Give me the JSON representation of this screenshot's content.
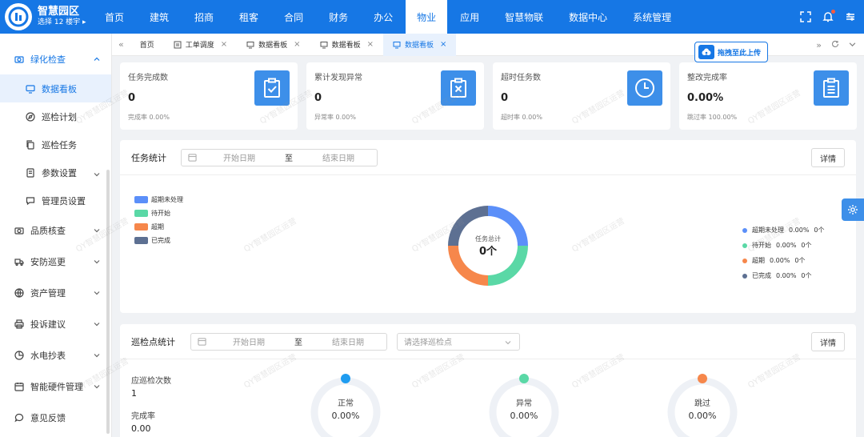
{
  "app": {
    "title": "智慧园区",
    "building_selector": "选择 12 楼宇",
    "colors": {
      "primary": "#1677e5",
      "card_icon": "#3d8fe9"
    }
  },
  "topnav": {
    "items": [
      "首页",
      "建筑",
      "招商",
      "租客",
      "合同",
      "财务",
      "办公",
      "物业",
      "应用",
      "智慧物联",
      "数据中心",
      "系统管理"
    ],
    "active": "物业"
  },
  "sidebar": {
    "group_open": "绿化检查",
    "sub_items": [
      "数据看板",
      "巡检计划",
      "巡检任务",
      "参数设置",
      "管理员设置"
    ],
    "active_sub": "数据看板",
    "groups": [
      "品质核查",
      "安防巡更",
      "资产管理",
      "投诉建议",
      "水电抄表",
      "智能硬件管理",
      "意见反馈"
    ]
  },
  "tabs": {
    "items": [
      {
        "label": "首页",
        "closable": false
      },
      {
        "label": "工单调度",
        "closable": true
      },
      {
        "label": "数据看板",
        "closable": true
      },
      {
        "label": "数据看板",
        "closable": true
      },
      {
        "label": "数据看板",
        "closable": true
      }
    ],
    "active_index": 4
  },
  "upload_button": "拖拽至此上传",
  "cards": [
    {
      "title": "任务完成数",
      "value": "0",
      "foot": "完成率 0.00%",
      "icon": "clipboard-check-icon"
    },
    {
      "title": "累计发现异常",
      "value": "0",
      "foot": "异常率 0.00%",
      "icon": "clipboard-x-icon"
    },
    {
      "title": "超时任务数",
      "value": "0",
      "foot": "超时率 0.00%",
      "icon": "clock-icon"
    },
    {
      "title": "整改完成率",
      "value": "0.00%",
      "foot": "跳过率 100.00%",
      "icon": "clipboard-list-icon"
    }
  ],
  "task_stats": {
    "title": "任务统计",
    "start_placeholder": "开始日期",
    "to": "至",
    "end_placeholder": "结束日期",
    "detail": "详情",
    "center_label": "任务总计",
    "center_value": "0个",
    "legend": [
      {
        "name": "超期未处理",
        "color": "#5b8ff9",
        "pct": "0.00%",
        "count": "0个"
      },
      {
        "name": "待开始",
        "color": "#5ad8a6",
        "pct": "0.00%",
        "count": "0个"
      },
      {
        "name": "超期",
        "color": "#f6874b",
        "pct": "0.00%",
        "count": "0个"
      },
      {
        "name": "已完成",
        "color": "#5d7092",
        "pct": "0.00%",
        "count": "0个"
      }
    ]
  },
  "patrol_stats": {
    "title": "巡检点统计",
    "start_placeholder": "开始日期",
    "to": "至",
    "end_placeholder": "结束日期",
    "select_placeholder": "请选择巡检点",
    "detail": "详情",
    "should_label": "应巡检次数",
    "should_value": "1",
    "rate_label": "完成率",
    "rate_value": "0.00",
    "rings": [
      {
        "label": "正常",
        "value": "0.00%",
        "color": "#1f9cf0"
      },
      {
        "label": "异常",
        "value": "0.00%",
        "color": "#5ad8a6"
      },
      {
        "label": "跳过",
        "value": "0.00%",
        "color": "#f6874b"
      }
    ]
  },
  "watermark": "QY智慧园区运营"
}
